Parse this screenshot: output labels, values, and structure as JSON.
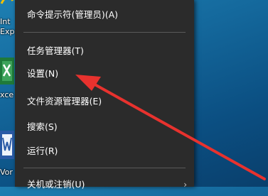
{
  "desktop": {
    "icons": [
      {
        "name": "internet-explorer",
        "label_lines": [
          "Int",
          "Exp"
        ]
      },
      {
        "name": "excel",
        "label_lines": [
          "xce"
        ]
      },
      {
        "name": "word",
        "label_lines": [
          "Vor"
        ]
      }
    ]
  },
  "context_menu": {
    "items": [
      {
        "label": "命令提示符(管理员)(A)"
      },
      {
        "label": "任务管理器(T)"
      },
      {
        "label": "设置(N)"
      },
      {
        "label": "文件资源管理器(E)"
      },
      {
        "label": "搜索(S)"
      },
      {
        "label": "运行(R)"
      },
      {
        "label": "关机或注销(U)"
      }
    ],
    "submenu_chevron": "›"
  },
  "annotation": {
    "arrow_color": "#e8322e"
  }
}
